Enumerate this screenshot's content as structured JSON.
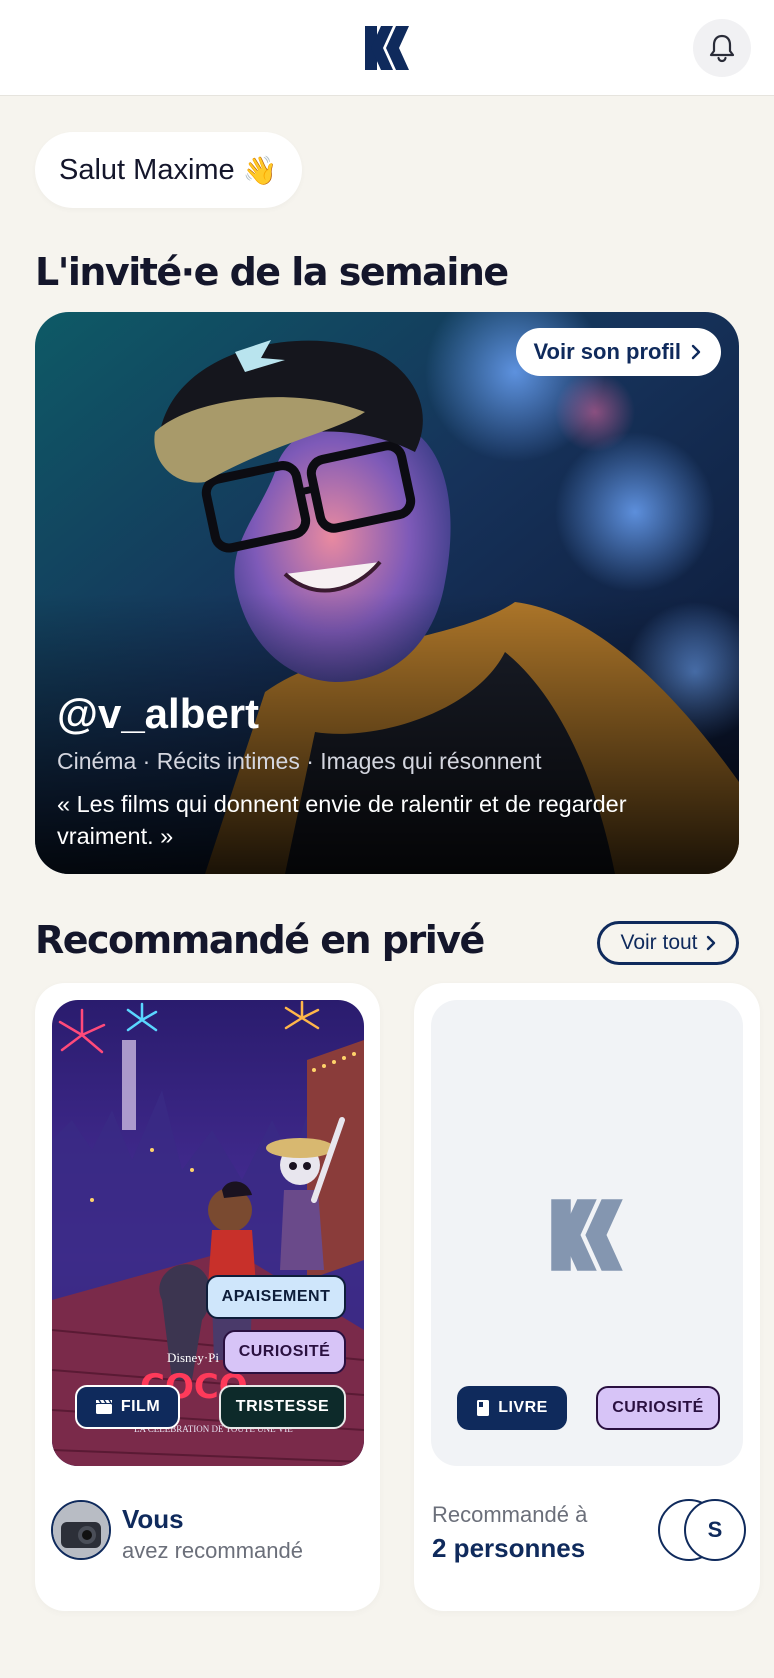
{
  "header": {
    "logo_icon": "brand-logo-icon",
    "notification_icon": "bell-icon"
  },
  "greeting": {
    "text": "Salut Maxime",
    "emoji": "👋"
  },
  "guest_section": {
    "title": "L'invité·e de la semaine",
    "profile_button": "Voir son profil",
    "handle": "@v_albert",
    "tags": "Cinéma · Récits intimes · Images qui résonnent",
    "quote": "« Les films qui donnent envie de ralentir et de regarder vraiment. »"
  },
  "private_section": {
    "title": "Recommandé en privé",
    "see_all": "Voir tout"
  },
  "recommendations": [
    {
      "type_label": "FILM",
      "type_icon": "clapperboard-icon",
      "emotions": [
        "APAISEMENT",
        "CURIOSITÉ",
        "TRISTESSE"
      ],
      "by_strong": "Vous",
      "by_sub": "avez recommandé"
    },
    {
      "type_label": "LIVRE",
      "type_icon": "book-icon",
      "emotions": [
        "CURIOSITÉ"
      ],
      "to_sub": "Recommandé à",
      "to_strong": "2 personnes",
      "avatar_initial": "S"
    }
  ],
  "colors": {
    "brand_navy": "#0f2a5c",
    "background": "#f6f4ee",
    "emotion_blue": "#cfe6fb",
    "emotion_purple": "#d7c4f7"
  }
}
